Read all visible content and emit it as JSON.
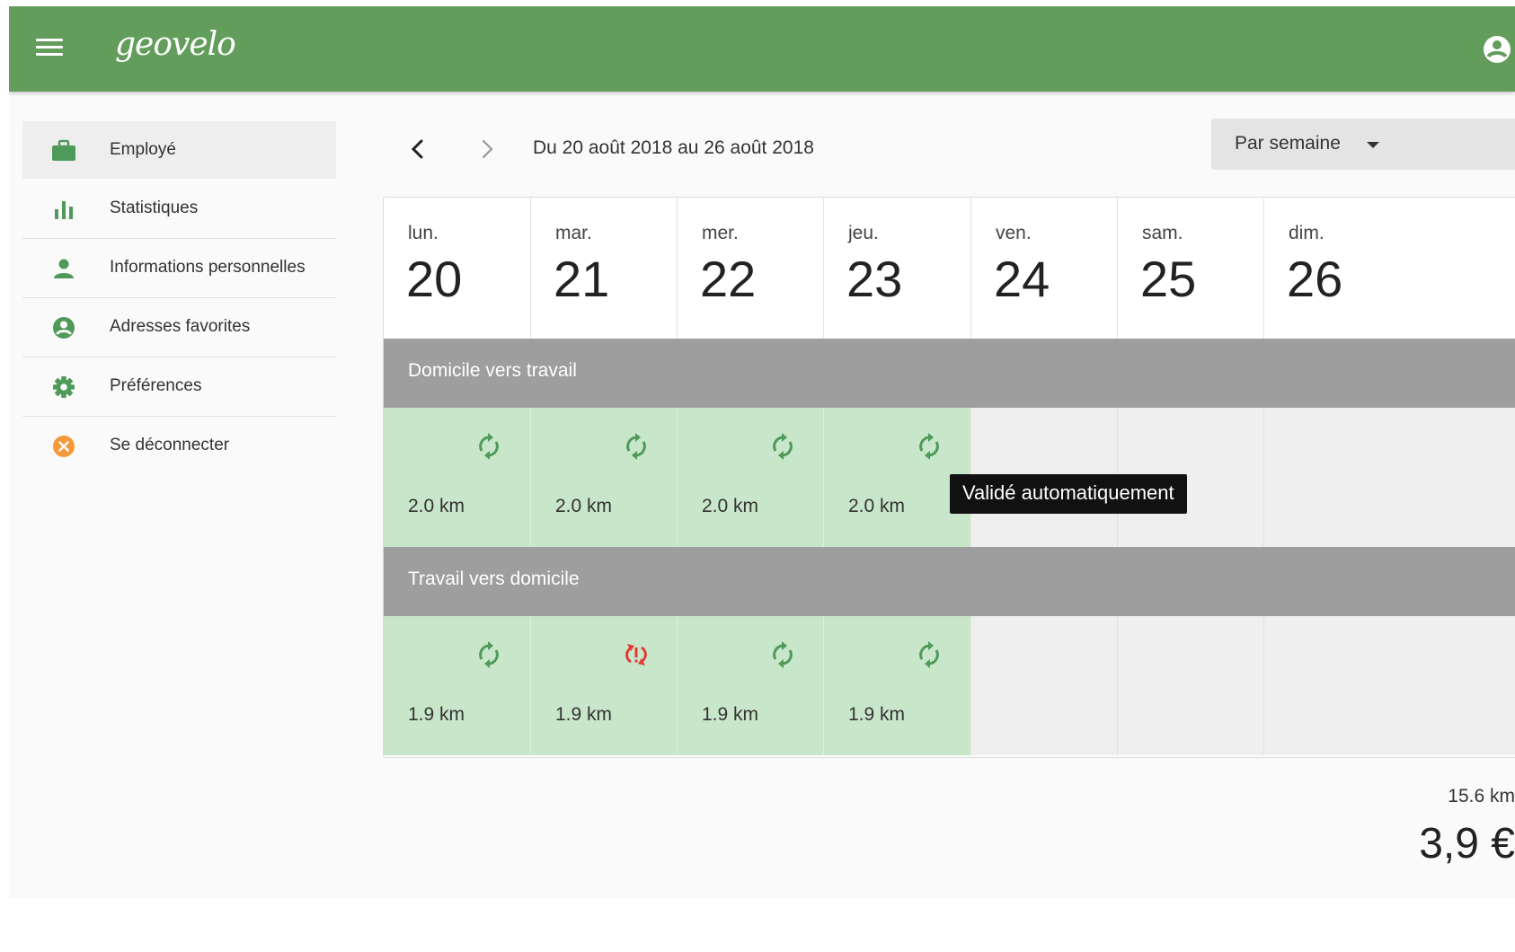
{
  "app": {
    "logo": "geovelo",
    "accent_color": "#639d5c"
  },
  "sidebar": {
    "items": [
      {
        "label": "Employé",
        "icon": "briefcase-icon",
        "active": true
      },
      {
        "label": "Statistiques",
        "icon": "bar-chart-icon"
      },
      {
        "label": "Informations personnelles",
        "icon": "person-icon"
      },
      {
        "label": "Adresses favorites",
        "icon": "account-circle-icon"
      },
      {
        "label": "Préférences",
        "icon": "gear-icon"
      },
      {
        "label": "Se déconnecter",
        "icon": "logout-icon",
        "color": "#f59a3a"
      }
    ]
  },
  "toolbar": {
    "period": "Du 20 août 2018 au 26 août 2018",
    "view_select": "Par semaine"
  },
  "calendar": {
    "days": [
      {
        "name": "lun.",
        "num": "20"
      },
      {
        "name": "mar.",
        "num": "21"
      },
      {
        "name": "mer.",
        "num": "22"
      },
      {
        "name": "jeu.",
        "num": "23"
      },
      {
        "name": "ven.",
        "num": "24"
      },
      {
        "name": "sam.",
        "num": "25"
      },
      {
        "name": "dim.",
        "num": "26"
      }
    ],
    "sections": [
      {
        "title": "Domicile vers travail",
        "trips": [
          {
            "distance": "2.0 km",
            "status": "validated",
            "icon": "sync-icon"
          },
          {
            "distance": "2.0 km",
            "status": "validated",
            "icon": "sync-icon"
          },
          {
            "distance": "2.0 km",
            "status": "validated",
            "icon": "sync-icon"
          },
          {
            "distance": "2.0 km",
            "status": "validated",
            "icon": "sync-icon"
          },
          null,
          null,
          null
        ]
      },
      {
        "title": "Travail vers domicile",
        "trips": [
          {
            "distance": "1.9 km",
            "status": "validated",
            "icon": "sync-icon"
          },
          {
            "distance": "1.9 km",
            "status": "problem",
            "icon": "sync-problem-icon"
          },
          {
            "distance": "1.9 km",
            "status": "validated",
            "icon": "sync-icon"
          },
          {
            "distance": "1.9 km",
            "status": "validated",
            "icon": "sync-icon"
          },
          null,
          null,
          null
        ]
      }
    ],
    "status_colors": {
      "validated": "#4f9a5a",
      "problem": "#e53935"
    }
  },
  "tooltip": "Validé automatiquement",
  "totals": {
    "distance": "15.6 km",
    "amount": "3,9 €"
  }
}
